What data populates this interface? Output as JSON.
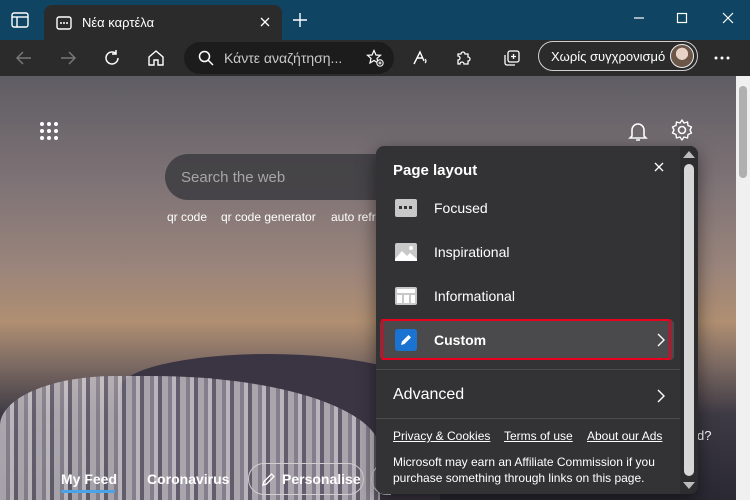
{
  "browser": {
    "tab_title": "Νέα καρτέλα",
    "address_placeholder": "Κάντε αναζήτηση...",
    "sync_label": "Χωρίς συγχρονισμό",
    "icons": {
      "tab_actions": "tab-actions-icon",
      "back": "back-arrow-icon",
      "forward": "forward-arrow-icon",
      "refresh": "refresh-icon",
      "home": "home-icon",
      "search": "search-icon",
      "favorite": "add-favorite-icon",
      "read_aloud": "read-aloud-icon",
      "extensions": "extensions-icon",
      "collections": "collections-icon",
      "more": "more-icon"
    }
  },
  "newtab": {
    "search_placeholder": "Search the web",
    "suggestions": [
      "qr code",
      "qr code generator",
      "auto refr"
    ],
    "feed_tabs": [
      "My Feed",
      "Coronavirus"
    ],
    "personalise_label": "Personalise",
    "partial_text": "d?"
  },
  "panel": {
    "title": "Page layout",
    "options": [
      {
        "label": "Focused",
        "icon": "focused-layout-icon"
      },
      {
        "label": "Inspirational",
        "icon": "inspirational-layout-icon"
      },
      {
        "label": "Informational",
        "icon": "informational-layout-icon"
      },
      {
        "label": "Custom",
        "icon": "custom-edit-icon",
        "selected": true
      }
    ],
    "advanced_label": "Advanced",
    "links": [
      "Privacy & Cookies",
      "Terms of use",
      "About our Ads"
    ],
    "note": "Microsoft may earn an Affiliate Commission if you purchase something through links on this page."
  },
  "colors": {
    "titlebar": "#0f4563",
    "toolbar": "#2b2b2b",
    "panel": "#333335",
    "highlight": "#e8001c",
    "accent": "#1a73d1",
    "feed_underline": "#4aa3e8"
  }
}
